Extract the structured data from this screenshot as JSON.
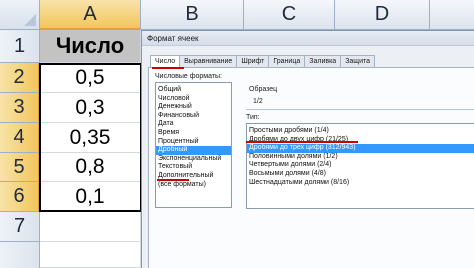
{
  "spreadsheet": {
    "columns": [
      "A",
      "B",
      "C",
      "D"
    ],
    "selected_column": "A",
    "rows": [
      "1",
      "2",
      "3",
      "4",
      "5",
      "6",
      "7"
    ],
    "selected_rows": [
      "2",
      "3",
      "4",
      "5",
      "6"
    ],
    "cells": {
      "A1": "Число",
      "A2": "0,5",
      "A3": "0,3",
      "A4": "0,35",
      "A5": "0,8",
      "A6": "0,1"
    },
    "colors": {
      "header_cell": "#c3c3c3",
      "selection_header": "#f2c65c"
    }
  },
  "dialog": {
    "title": "Формат ячеек",
    "tabs": [
      "Число",
      "Выравнивание",
      "Шрифт",
      "Граница",
      "Заливка",
      "Защита"
    ],
    "active_tab": "Число",
    "formats_label": "Числовые форматы:",
    "formats": [
      "Общий",
      "Числовой",
      "Денежный",
      "Финансовый",
      "Дата",
      "Время",
      "Процентный",
      "Дробный",
      "Экспоненциальный",
      "Текстовый",
      "Дополнительный",
      "(все форматы)"
    ],
    "selected_format": "Дробный",
    "sample_label": "Образец",
    "sample_value": "1/2",
    "type_label": "Тип:",
    "types": [
      "Простыми дробями (1/4)",
      "Дробями до двух цифр (21/25)",
      "Дробями до трех цифр (312/943)",
      "Половинными долями (1/2)",
      "Четвертыми долями (2/4)",
      "Восьмыми долями (4/8)",
      "Шестнадцатыми долями (8/16)"
    ],
    "selected_type": "Дробями до трех цифр (312/943)",
    "colors": {
      "selection": "#3399ff",
      "annotation": "#cc0000"
    }
  }
}
